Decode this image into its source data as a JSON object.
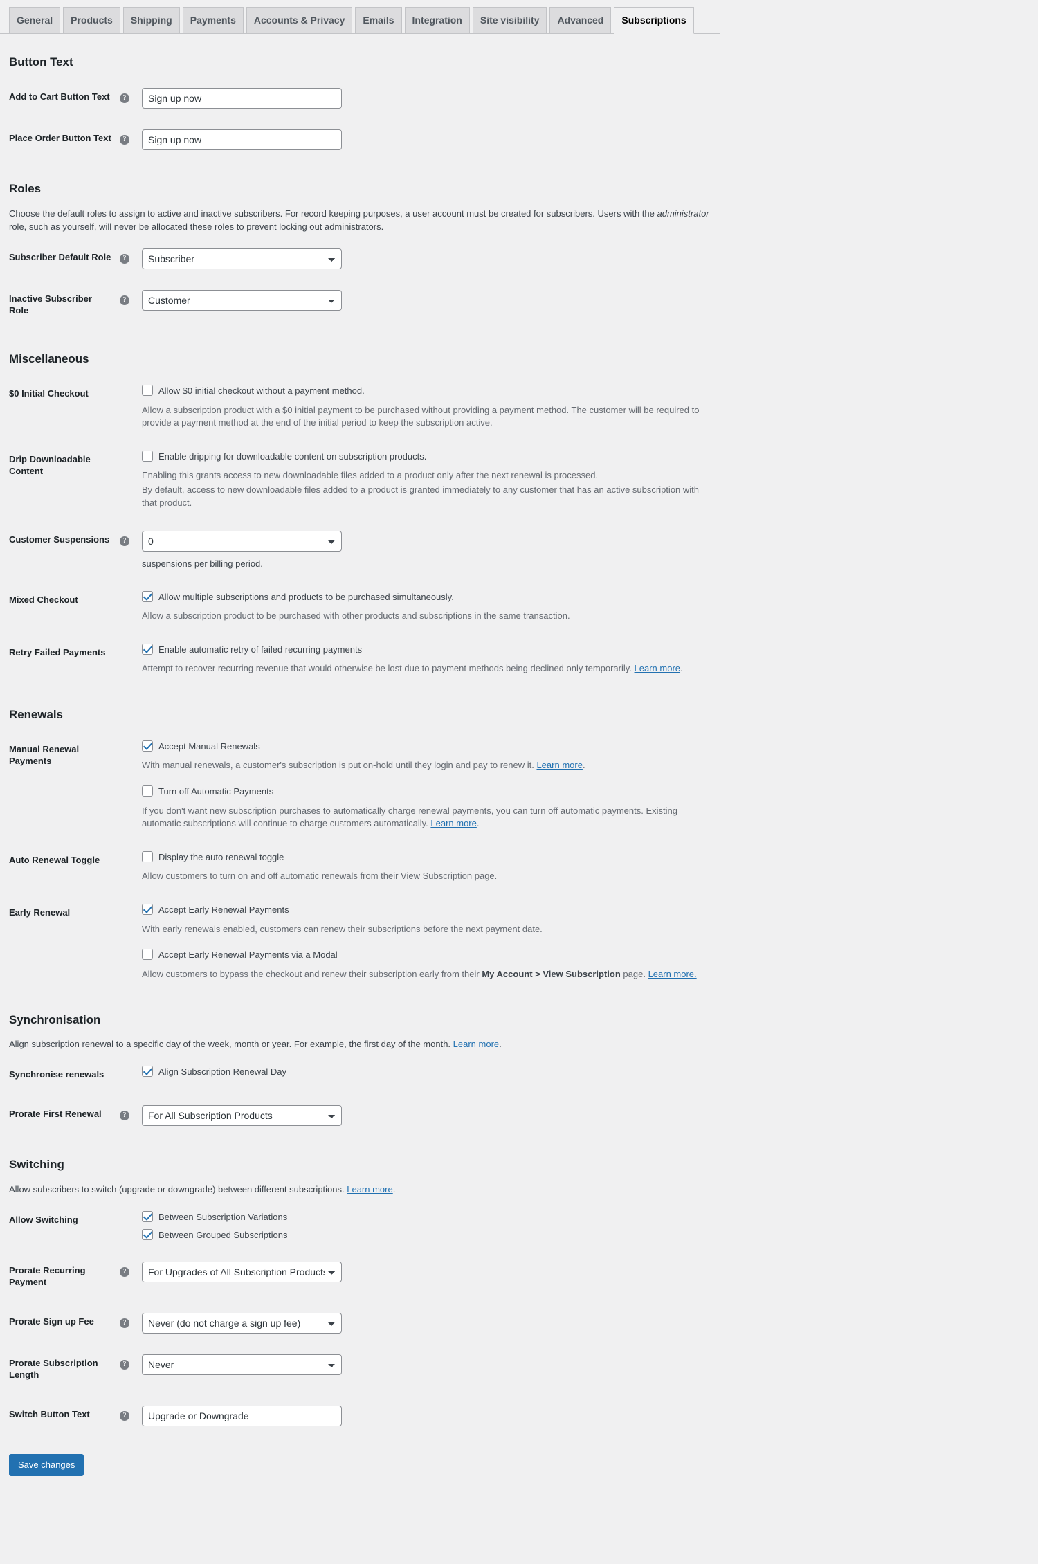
{
  "tabs": [
    {
      "label": "General",
      "active": false
    },
    {
      "label": "Products",
      "active": false
    },
    {
      "label": "Shipping",
      "active": false
    },
    {
      "label": "Payments",
      "active": false
    },
    {
      "label": "Accounts & Privacy",
      "active": false
    },
    {
      "label": "Emails",
      "active": false
    },
    {
      "label": "Integration",
      "active": false
    },
    {
      "label": "Site visibility",
      "active": false
    },
    {
      "label": "Advanced",
      "active": false
    },
    {
      "label": "Subscriptions",
      "active": true
    }
  ],
  "help_glyph": "?",
  "sections": {
    "button_text": {
      "title": "Button Text",
      "add_to_cart": {
        "label": "Add to Cart Button Text",
        "value": "Sign up now"
      },
      "place_order": {
        "label": "Place Order Button Text",
        "value": "Sign up now"
      }
    },
    "roles": {
      "title": "Roles",
      "description_part1": "Choose the default roles to assign to active and inactive subscribers. For record keeping purposes, a user account must be created for subscribers. Users with the ",
      "description_em": "administrator",
      "description_part2": " role, such as yourself, will never be allocated these roles to prevent locking out administrators.",
      "subscriber_default": {
        "label": "Subscriber Default Role",
        "value": "Subscriber"
      },
      "inactive_subscriber": {
        "label": "Inactive Subscriber Role",
        "value": "Customer"
      }
    },
    "miscellaneous": {
      "title": "Miscellaneous",
      "zero_initial_checkout": {
        "label": "$0 Initial Checkout",
        "checkbox_label": "Allow $0 initial checkout without a payment method.",
        "checked": false,
        "description": "Allow a subscription product with a $0 initial payment to be purchased without providing a payment method. The customer will be required to provide a payment method at the end of the initial period to keep the subscription active."
      },
      "drip_downloadable": {
        "label": "Drip Downloadable Content",
        "checkbox_label": "Enable dripping for downloadable content on subscription products.",
        "checked": false,
        "description_line1": "Enabling this grants access to new downloadable files added to a product only after the next renewal is processed.",
        "description_line2": "By default, access to new downloadable files added to a product is granted immediately to any customer that has an active subscription with that product."
      },
      "customer_suspensions": {
        "label": "Customer Suspensions",
        "value": "0",
        "unit_text": "suspensions per billing period."
      },
      "mixed_checkout": {
        "label": "Mixed Checkout",
        "checkbox_label": "Allow multiple subscriptions and products to be purchased simultaneously.",
        "checked": true,
        "description": "Allow a subscription product to be purchased with other products and subscriptions in the same transaction."
      },
      "retry_failed_payments": {
        "label": "Retry Failed Payments",
        "checkbox_label": "Enable automatic retry of failed recurring payments",
        "checked": true,
        "description_text": "Attempt to recover recurring revenue that would otherwise be lost due to payment methods being declined only temporarily. ",
        "description_link": "Learn more"
      }
    },
    "renewals": {
      "title": "Renewals",
      "manual_renewal_payments": {
        "label": "Manual Renewal Payments",
        "checkbox1_label": "Accept Manual Renewals",
        "checkbox1_checked": true,
        "description1_text": "With manual renewals, a customer's subscription is put on-hold until they login and pay to renew it. ",
        "description1_link": "Learn more",
        "checkbox2_label": "Turn off Automatic Payments",
        "checkbox2_checked": false,
        "description2_text": "If you don't want new subscription purchases to automatically charge renewal payments, you can turn off automatic payments. Existing automatic subscriptions will continue to charge customers automatically. ",
        "description2_link": "Learn more"
      },
      "auto_renewal_toggle": {
        "label": "Auto Renewal Toggle",
        "checkbox_label": "Display the auto renewal toggle",
        "checked": false,
        "description": "Allow customers to turn on and off automatic renewals from their View Subscription page."
      },
      "early_renewal": {
        "label": "Early Renewal",
        "checkbox1_label": "Accept Early Renewal Payments",
        "checkbox1_checked": true,
        "description1": "With early renewals enabled, customers can renew their subscriptions before the next payment date.",
        "checkbox2_label": "Accept Early Renewal Payments via a Modal",
        "checkbox2_checked": false,
        "description2_part1": "Allow customers to bypass the checkout and renew their subscription early from their ",
        "description2_bold": "My Account > View Subscription",
        "description2_part2": " page. ",
        "description2_link": "Learn more."
      }
    },
    "synchronisation": {
      "title": "Synchronisation",
      "description_text": "Align subscription renewal to a specific day of the week, month or year. For example, the first day of the month. ",
      "description_link": "Learn more",
      "description_tail": ".",
      "synchronise_renewals": {
        "label": "Synchronise renewals",
        "checkbox_label": "Align Subscription Renewal Day",
        "checked": true
      },
      "prorate_first_renewal": {
        "label": "Prorate First Renewal",
        "value": "For All Subscription Products"
      }
    },
    "switching": {
      "title": "Switching",
      "description_text": "Allow subscribers to switch (upgrade or downgrade) between different subscriptions. ",
      "description_link": "Learn more",
      "description_tail": ".",
      "allow_switching": {
        "label": "Allow Switching",
        "checkbox1_label": "Between Subscription Variations",
        "checkbox1_checked": true,
        "checkbox2_label": "Between Grouped Subscriptions",
        "checkbox2_checked": true
      },
      "prorate_recurring_payment": {
        "label": "Prorate Recurring Payment",
        "value": "For Upgrades of All Subscription Products"
      },
      "prorate_sign_up_fee": {
        "label": "Prorate Sign up Fee",
        "value": "Never (do not charge a sign up fee)"
      },
      "prorate_subscription_length": {
        "label": "Prorate Subscription Length",
        "value": "Never"
      },
      "switch_button_text": {
        "label": "Switch Button Text",
        "value": "Upgrade or Downgrade"
      }
    }
  },
  "submit": {
    "save_label": "Save changes"
  }
}
